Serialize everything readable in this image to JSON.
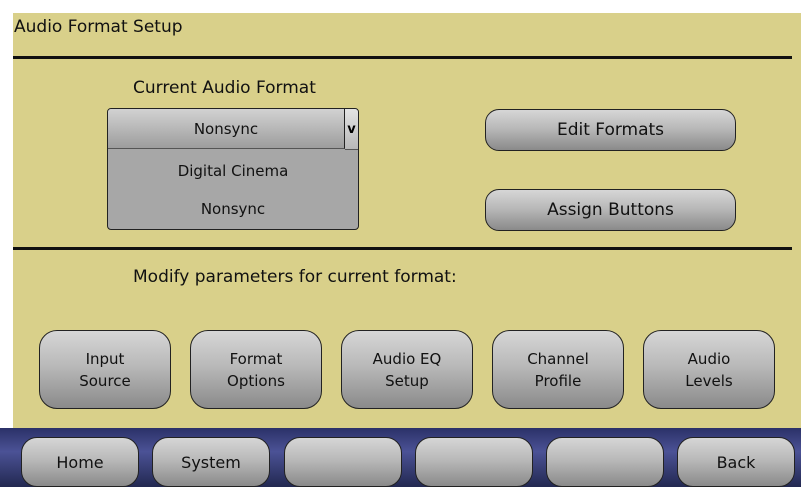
{
  "header": {
    "title": "Audio Format Setup"
  },
  "format": {
    "heading": "Current Audio Format",
    "selected": "Nonsync",
    "arrow": "v",
    "options": [
      "Digital Cinema",
      "Nonsync"
    ]
  },
  "actions": {
    "edit_formats": "Edit Formats",
    "assign_buttons": "Assign Buttons"
  },
  "modify": {
    "heading": "Modify parameters for current format:",
    "buttons": [
      {
        "line1": "Input",
        "line2": "Source"
      },
      {
        "line1": "Format",
        "line2": "Options"
      },
      {
        "line1": "Audio EQ",
        "line2": "Setup"
      },
      {
        "line1": "Channel",
        "line2": "Profile"
      },
      {
        "line1": "Audio",
        "line2": "Levels"
      }
    ]
  },
  "nav": {
    "home": "Home",
    "system": "System",
    "blank1": "",
    "blank2": "",
    "blank3": "",
    "back": "Back"
  }
}
